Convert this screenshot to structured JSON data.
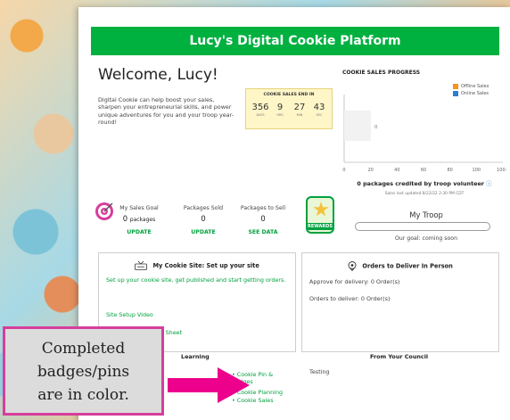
{
  "banner": {
    "title": "Lucy's Digital Cookie Platform"
  },
  "welcome": {
    "title": "Welcome, Lucy!",
    "text": "Digital Cookie can help boost your sales, sharpen your entrepreneurial skills, and power unique adventures for you and your troop year-round!"
  },
  "countdown": {
    "title": "COOKIE SALES END IN",
    "units": [
      {
        "value": "356",
        "label": "DAYS"
      },
      {
        "value": "9",
        "label": "HRS"
      },
      {
        "value": "27",
        "label": "MIN"
      },
      {
        "value": "43",
        "label": "SEC"
      }
    ]
  },
  "chart_data": {
    "type": "bar",
    "title": "COOKIE SALES PROGRESS",
    "orientation": "horizontal",
    "categories": [
      ""
    ],
    "series": [
      {
        "name": "Offline Sales",
        "color": "#f7941d",
        "values": [
          0
        ]
      },
      {
        "name": "Online Sales",
        "color": "#2a7dd1",
        "values": [
          0
        ]
      }
    ],
    "value_label": "0",
    "xticks": [
      "0",
      "20",
      "40",
      "60",
      "80",
      "100",
      "100+"
    ],
    "xlim": [
      0,
      100
    ],
    "legend": "top-right",
    "grid": false
  },
  "progress": {
    "credit_text": "0 packages credited by troop volunteer",
    "info_icon": "ⓘ",
    "updated_text": "Sales last updated 8/22/22 2:30 PM CDT"
  },
  "stats": [
    {
      "label": "My Sales Goal",
      "value": "0",
      "unit": "packages",
      "link": "UPDATE"
    },
    {
      "label": "Packages Sold",
      "value": "0",
      "unit": "",
      "link": "UPDATE"
    },
    {
      "label": "Packages to Sell",
      "value": "0",
      "unit": "",
      "link": "SEE DATA"
    }
  ],
  "rewards": {
    "label": "REWARDS"
  },
  "troop": {
    "title": "My Troop",
    "progress": 0,
    "goal": "Our goal: coming soon"
  },
  "cookie_site": {
    "title": "My Cookie Site: Set up your site",
    "icon": "closed-sign-icon",
    "setup_link": "Set up your cookie site, get published and start getting orders.",
    "video_link": "Site Setup Video",
    "tip_sheet_link": "Site Setup Quick Tip Sheet"
  },
  "orders": {
    "title": "Orders to Deliver In Person",
    "icon": "location-pin-icon",
    "approve_text": "Approve for delivery:  0 Order(s)",
    "deliver_text": "Orders to deliver:  0 Order(s)"
  },
  "learning": {
    "title": "Learning",
    "links": [
      "• Cookie Pin & Badges",
      "• Cookie Planning",
      "• Cookie Sales"
    ]
  },
  "council": {
    "title": "From Your Council",
    "text": "Testing"
  },
  "callout": {
    "lines": [
      "Completed",
      "badges/pins",
      "are in color."
    ]
  },
  "colors": {
    "brand_green": "#00b140",
    "link_green": "#00a13f",
    "callout_border": "#d63e9c",
    "arrow": "#ec008c"
  }
}
